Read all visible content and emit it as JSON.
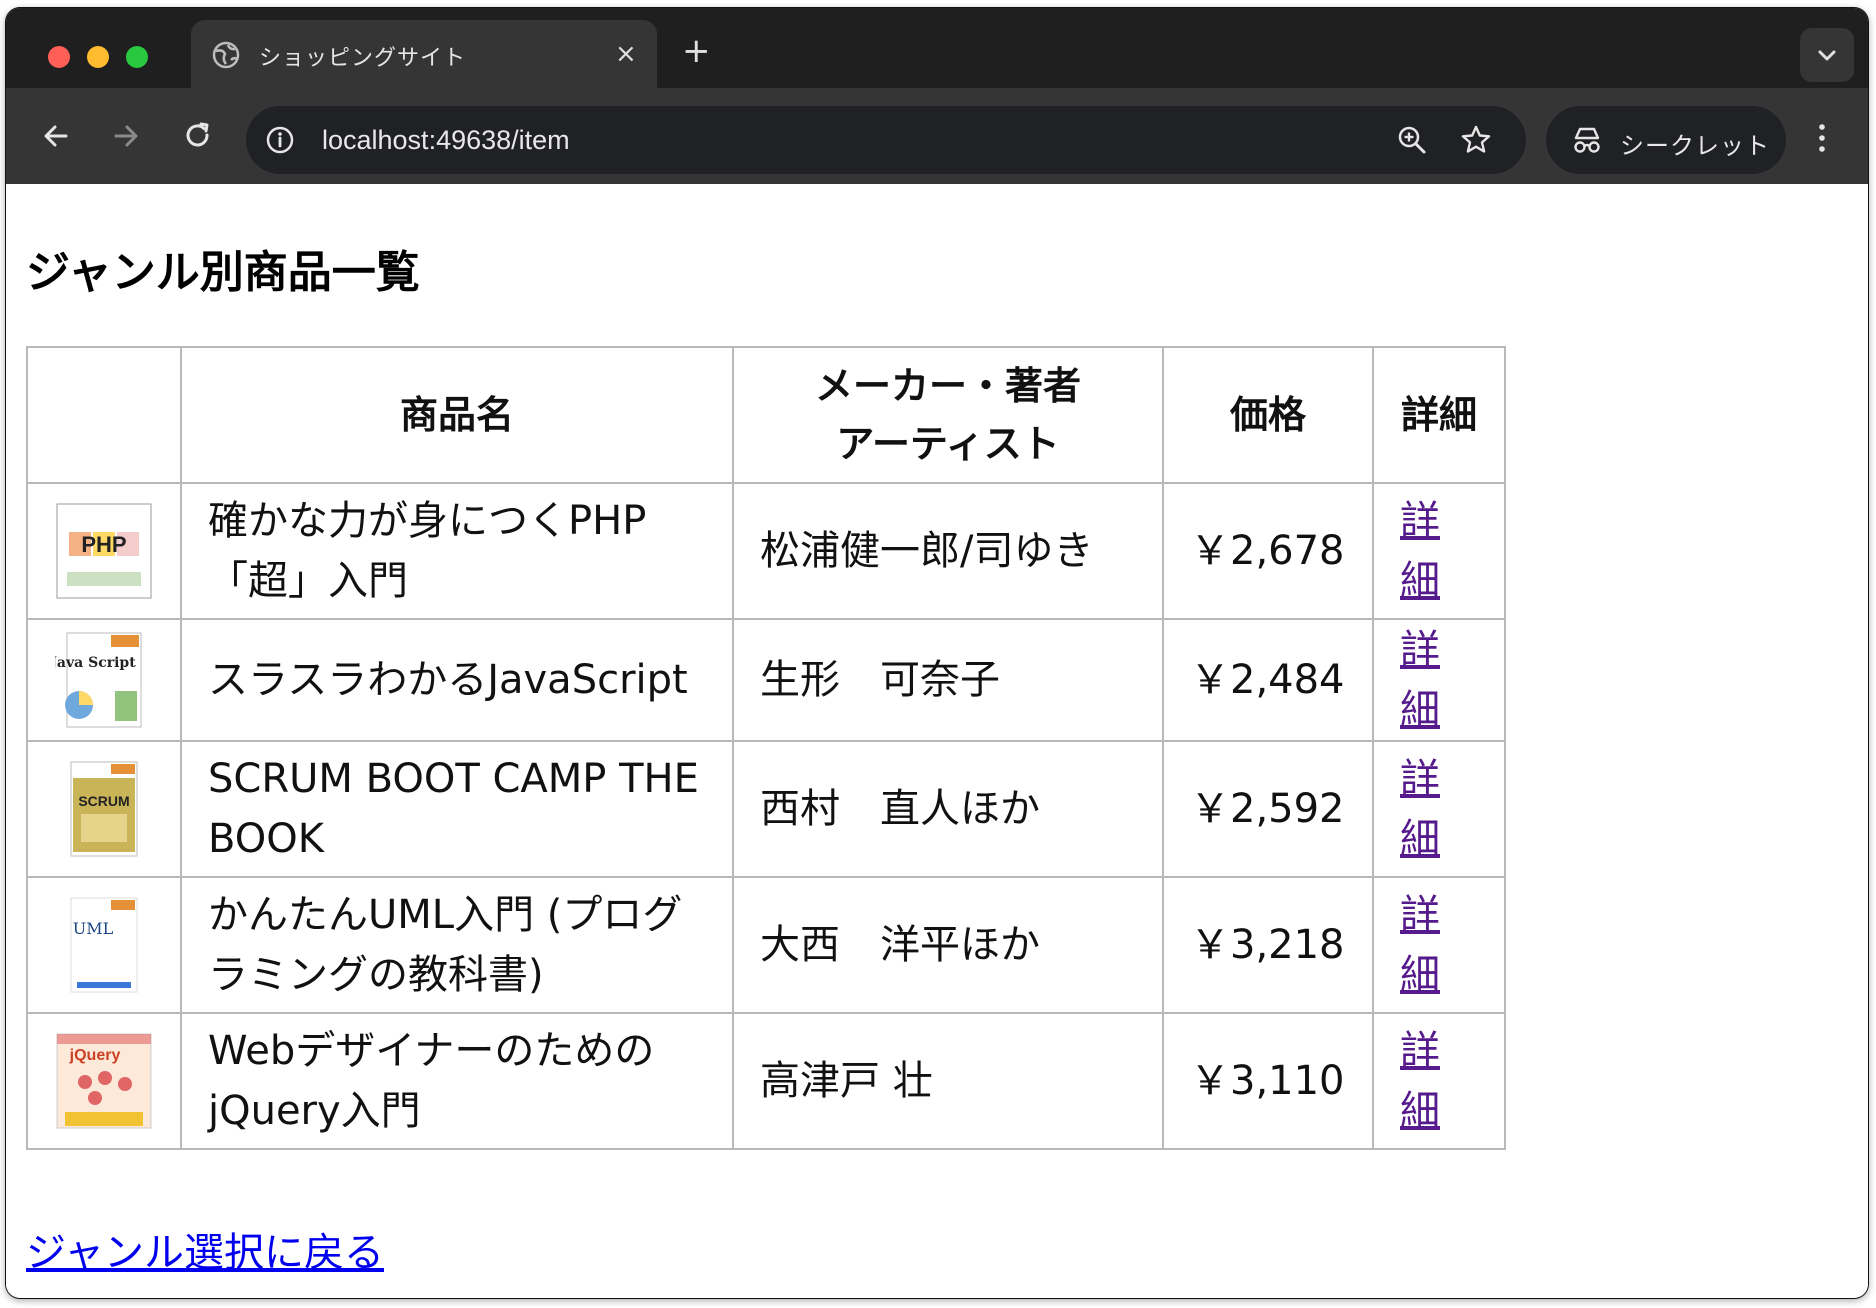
{
  "browser": {
    "tab_title": "ショッピングサイト",
    "tab_close": "×",
    "new_tab": "+",
    "url": "localhost:49638/item",
    "incognito_label": "シークレット"
  },
  "page": {
    "heading": "ジャンル別商品一覧",
    "columns": {
      "image": "",
      "name": "商品名",
      "maker_line1": "メーカー・著者",
      "maker_line2": "アーティスト",
      "price": "価格",
      "detail": "詳細"
    },
    "items": [
      {
        "name": "確かな力が身につくPHP「超」入門",
        "maker": "松浦健一郎/司ゆき",
        "price": "￥2,678",
        "detail": "詳細",
        "cover_text": "PHP",
        "cover_color": "#6aa84f"
      },
      {
        "name": "スラスラわかるJavaScript",
        "maker": "生形　可奈子",
        "price": "￥2,484",
        "detail": "詳細",
        "cover_text": "Java Script",
        "cover_color": "#e69138"
      },
      {
        "name": "SCRUM BOOT CAMP THE BOOK",
        "maker": "西村　直人ほか",
        "price": "￥2,592",
        "detail": "詳細",
        "cover_text": "SCRUM",
        "cover_color": "#b59a3a"
      },
      {
        "name": "かんたんUML入門 (プログラミングの教科書)",
        "maker": "大西　洋平ほか",
        "price": "￥3,218",
        "detail": "詳細",
        "cover_text": "UML",
        "cover_color": "#3c78d8"
      },
      {
        "name": "Webデザイナーのための jQuery入門",
        "maker": "高津戸 壮",
        "price": "￥3,110",
        "detail": "詳細",
        "cover_text": "jQuery",
        "cover_color": "#cc4125"
      }
    ],
    "back_link": "ジャンル選択に戻る"
  }
}
